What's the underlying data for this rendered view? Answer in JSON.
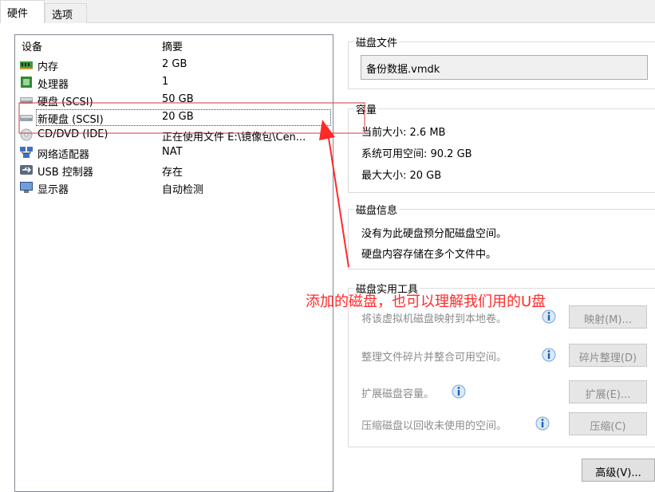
{
  "tabs": [
    "硬件",
    "选项"
  ],
  "devices": {
    "col_device": "设备",
    "col_summary": "摘要",
    "rows": [
      {
        "name": "内存",
        "summary": "2 GB",
        "icon": "memory-icon"
      },
      {
        "name": "处理器",
        "summary": "1",
        "icon": "processor-icon"
      },
      {
        "name": "硬盘 (SCSI)",
        "summary": "50 GB",
        "icon": "harddisk-icon"
      },
      {
        "name": "新硬盘 (SCSI)",
        "summary": "20 GB",
        "icon": "harddisk-icon"
      },
      {
        "name": "CD/DVD (IDE)",
        "summary": "正在使用文件 E:\\镜像包\\Cen...",
        "icon": "cd-icon"
      },
      {
        "name": "网络适配器",
        "summary": "NAT",
        "icon": "network-icon"
      },
      {
        "name": "USB 控制器",
        "summary": "存在",
        "icon": "usb-icon"
      },
      {
        "name": "显示器",
        "summary": "自动检测",
        "icon": "monitor-icon"
      }
    ]
  },
  "disk_file": {
    "title": "磁盘文件",
    "value": "备份数据.vmdk"
  },
  "capacity": {
    "title": "容量",
    "current": "当前大小: 2.6 MB",
    "available": "系统可用空间: 90.2 GB",
    "max": "最大大小: 20 GB"
  },
  "disk_info": {
    "title": "磁盘信息",
    "line1": "没有为此硬盘预分配磁盘空间。",
    "line2": "硬盘内容存储在多个文件中。"
  },
  "tools": {
    "title": "磁盘实用工具",
    "map_desc": "将该虚拟机磁盘映射到本地卷。",
    "map_btn": "映射(M)...",
    "defrag_desc": "整理文件碎片并整合可用空间。",
    "defrag_btn": "碎片整理(D)",
    "expand_desc": "扩展磁盘容量。",
    "expand_btn": "扩展(E)...",
    "compact_desc": "压缩磁盘以回收未使用的空间。",
    "compact_btn": "压缩(C)"
  },
  "advanced_btn": "高级(V)...",
  "annotation": "添加的磁盘，也可以理解我们用的U盘",
  "colors": {
    "annotation": "#ff2a2a",
    "selection_box": "#d23a3a"
  }
}
